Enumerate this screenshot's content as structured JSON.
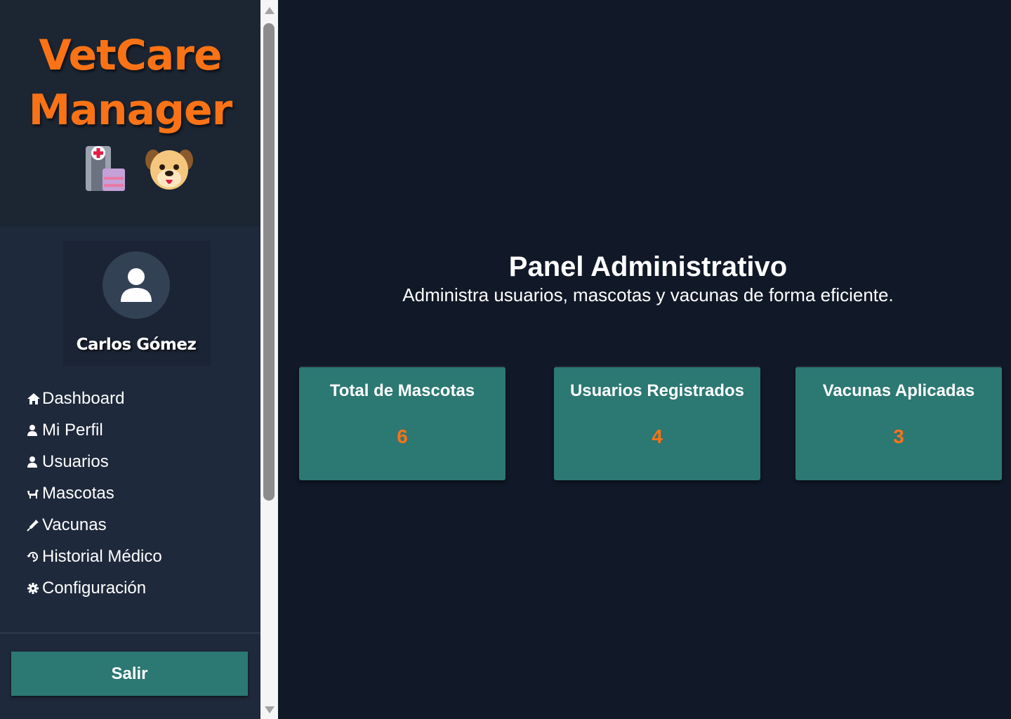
{
  "brand": {
    "line1": "VetCare",
    "line2": "Manager",
    "icons": [
      "hospital-icon",
      "dog-face-icon"
    ],
    "color": "#f97316"
  },
  "user": {
    "name": "Carlos Gómez",
    "avatar_icon": "user-icon"
  },
  "sidebar": {
    "items": [
      {
        "label": "Dashboard",
        "icon": "home-icon"
      },
      {
        "label": "Mi Perfil",
        "icon": "user-icon"
      },
      {
        "label": "Usuarios",
        "icon": "user-icon"
      },
      {
        "label": "Mascotas",
        "icon": "dog-icon"
      },
      {
        "label": "Vacunas",
        "icon": "syringe-icon"
      },
      {
        "label": "Historial Médico",
        "icon": "history-icon"
      },
      {
        "label": "Configuración",
        "icon": "gear-icon"
      }
    ],
    "logout_label": "Salir"
  },
  "main": {
    "title": "Panel Administrativo",
    "subtitle": "Administra usuarios, mascotas y vacunas de forma eficiente.",
    "cards": [
      {
        "title": "Total de Mascotas",
        "value": "6"
      },
      {
        "title": "Usuarios Registrados",
        "value": "4"
      },
      {
        "title": "Vacunas Aplicadas",
        "value": "3"
      }
    ]
  },
  "colors": {
    "page_background": "#111827",
    "sidebar_background": "#1e293b",
    "accent_teal": "#2c7873",
    "accent_orange": "#f97316",
    "text": "#ffffff"
  }
}
